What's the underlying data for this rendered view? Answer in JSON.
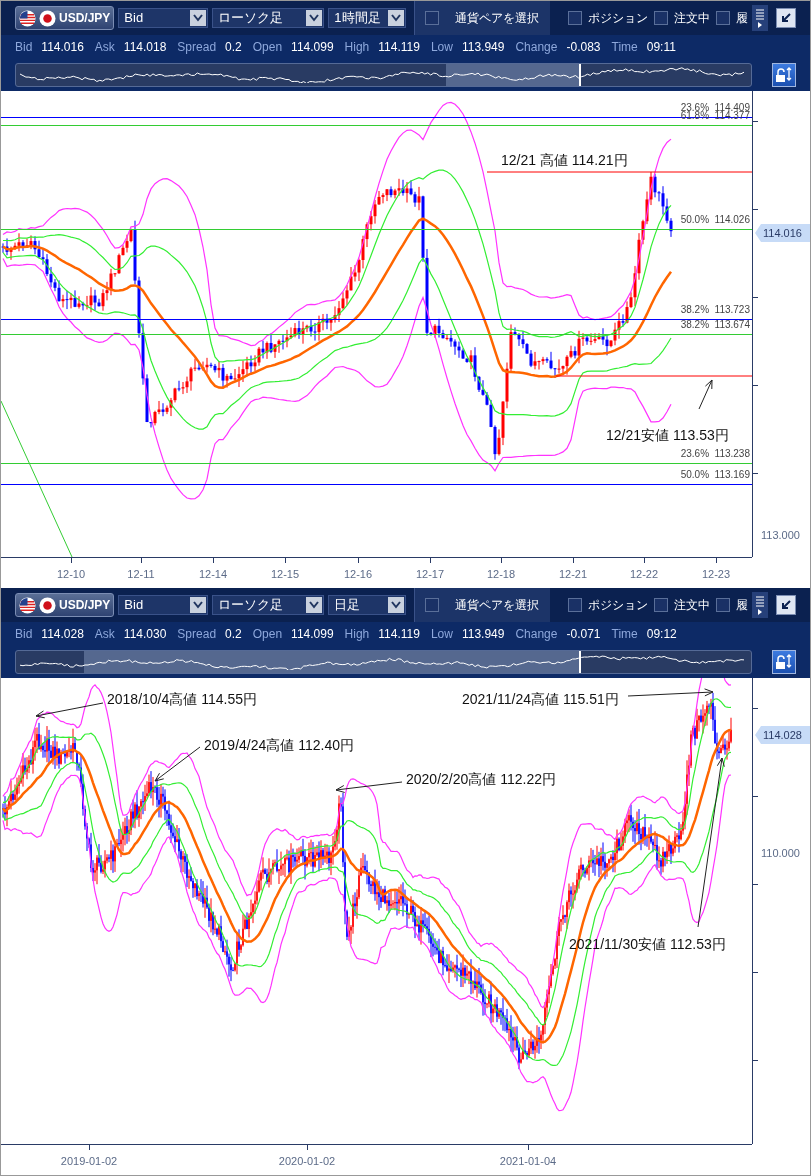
{
  "panels": [
    {
      "toolbar": {
        "pair": "USD/JPY",
        "price_type": "Bid",
        "chart_type": "ローソク足",
        "timeframe": "1時間足",
        "pair_select": {
          "label": "通貨ペアを選択",
          "checked": false
        },
        "toggles": [
          {
            "label": "ポジション",
            "checked": false
          },
          {
            "label": "注文中",
            "checked": false
          },
          {
            "label": "履",
            "checked": false
          }
        ]
      },
      "quote": [
        {
          "label": "Bid",
          "value": "114.016"
        },
        {
          "label": "Ask",
          "value": "114.018"
        },
        {
          "label": "Spread",
          "value": "0.2"
        },
        {
          "label": "Open",
          "value": "114.099"
        },
        {
          "label": "High",
          "value": "114.119"
        },
        {
          "label": "Low",
          "value": "113.949"
        },
        {
          "label": "Change",
          "value": "-0.083"
        },
        {
          "label": "Time",
          "value": "09:11"
        }
      ],
      "fib_levels": [
        {
          "label": "23.6%",
          "value": "114.409",
          "color": "#0000ff"
        },
        {
          "label": "61.8%",
          "value": "114.377",
          "color": "#33cc33"
        },
        {
          "label": "50.0%",
          "value": "114.026",
          "color": "#33cc33"
        },
        {
          "label": "38.2%",
          "value": "113.723",
          "color": "#0000ff"
        },
        {
          "label": "38.2%",
          "value": "113.674",
          "color": "#33cc33"
        },
        {
          "label": "23.6%",
          "value": "113.238",
          "color": "#33cc33"
        },
        {
          "label": "50.0%",
          "value": "113.169",
          "color": "#0000ff"
        }
      ],
      "annotations": [
        {
          "text": "12/21 高値 114.21円",
          "kind": "line"
        },
        {
          "text": "12/21安値 113.53円",
          "kind": "line_arrow"
        }
      ],
      "current_price": "114.016",
      "price_labels": [
        "113.000"
      ],
      "dates": [
        "12-10",
        "12-11",
        "12-14",
        "12-15",
        "12-16",
        "12-17",
        "12-18",
        "12-21",
        "12-22",
        "12-23"
      ]
    },
    {
      "toolbar": {
        "pair": "USD/JPY",
        "price_type": "Bid",
        "chart_type": "ローソク足",
        "timeframe": "日足",
        "pair_select": {
          "label": "通貨ペアを選択",
          "checked": false
        },
        "toggles": [
          {
            "label": "ポジション",
            "checked": false
          },
          {
            "label": "注文中",
            "checked": false
          },
          {
            "label": "履",
            "checked": false
          }
        ]
      },
      "quote": [
        {
          "label": "Bid",
          "value": "114.028"
        },
        {
          "label": "Ask",
          "value": "114.030"
        },
        {
          "label": "Spread",
          "value": "0.2"
        },
        {
          "label": "Open",
          "value": "114.099"
        },
        {
          "label": "High",
          "value": "114.119"
        },
        {
          "label": "Low",
          "value": "113.949"
        },
        {
          "label": "Change",
          "value": "-0.071"
        },
        {
          "label": "Time",
          "value": "09:12"
        }
      ],
      "annotations": [
        {
          "text": "2018/10/4高値 114.55円",
          "kind": "arrow"
        },
        {
          "text": "2019/4/24高値 112.40円",
          "kind": "arrow"
        },
        {
          "text": "2020/2/20高値 112.22円",
          "kind": "arrow"
        },
        {
          "text": "2021/11/24高値 115.51円",
          "kind": "arrow"
        },
        {
          "text": "2021/11/30安値 112.53円",
          "kind": "arrow"
        }
      ],
      "current_price": "114.028",
      "price_labels": [
        "110.000"
      ],
      "dates": [
        "2019-01-02",
        "2020-01-02",
        "2021-01-04"
      ]
    }
  ]
}
